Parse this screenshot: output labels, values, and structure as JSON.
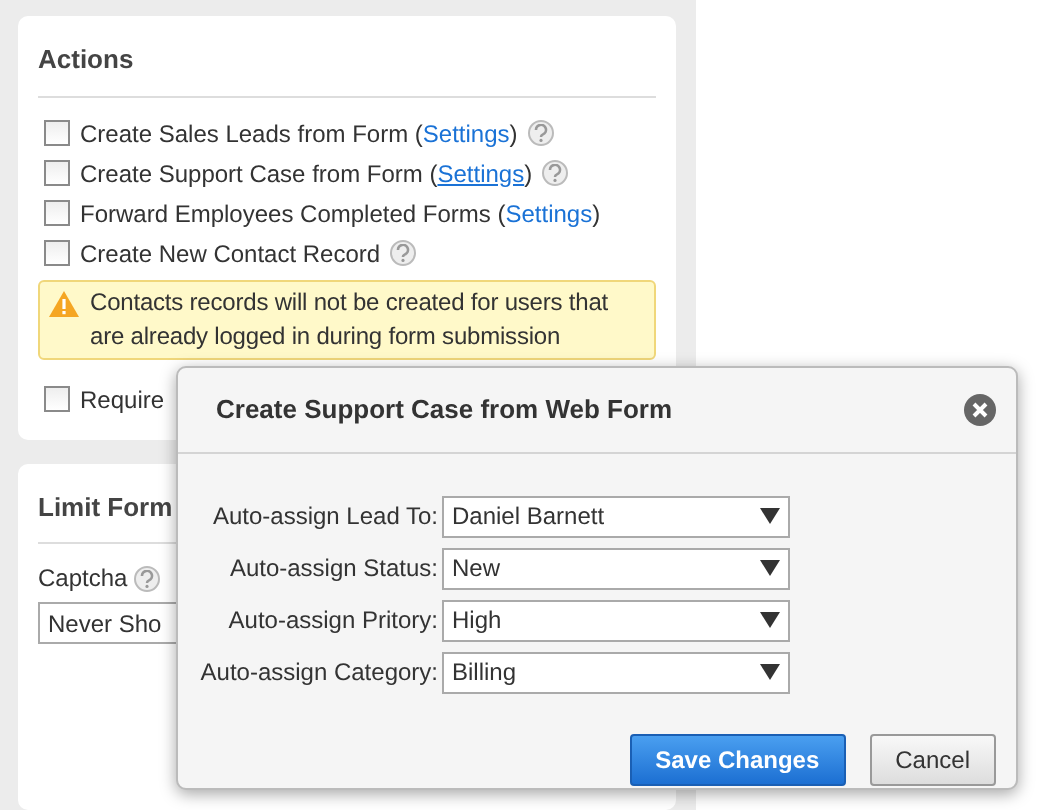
{
  "actions": {
    "title": "Actions",
    "items": [
      {
        "checked": false,
        "text": "Create Sales Leads from Form (",
        "link": {
          "label": "Settings",
          "hovered": false
        },
        "after": ")",
        "help": true
      },
      {
        "checked": false,
        "text": "Create Support Case from Form (",
        "link": {
          "label": "Settings",
          "hovered": true
        },
        "after": ")",
        "help": true
      },
      {
        "checked": false,
        "text": "Forward Employees Completed Forms (",
        "link": {
          "label": "Settings",
          "hovered": false
        },
        "after": ")",
        "help": false
      },
      {
        "checked": false,
        "text": "Create New Contact Record",
        "help": true
      }
    ],
    "warning": "Contacts records will not be created for users that are already logged in during form submission",
    "extra": {
      "checked": false,
      "text": "Require"
    }
  },
  "limit": {
    "title": "Limit Form",
    "captcha_label": "Captcha",
    "captcha_value": "Never Sho"
  },
  "dialog": {
    "title": "Create Support Case from Web Form",
    "fields": [
      {
        "label": "Auto-assign Lead To:",
        "value": "Daniel Barnett"
      },
      {
        "label": "Auto-assign Status:",
        "value": "New"
      },
      {
        "label": "Auto-assign Pritory:",
        "value": "High"
      },
      {
        "label": "Auto-assign Category:",
        "value": "Billing"
      }
    ],
    "buttons": [
      {
        "label": "Save Changes",
        "kind": "primary"
      },
      {
        "label": "Cancel",
        "kind": "secondary"
      }
    ]
  }
}
